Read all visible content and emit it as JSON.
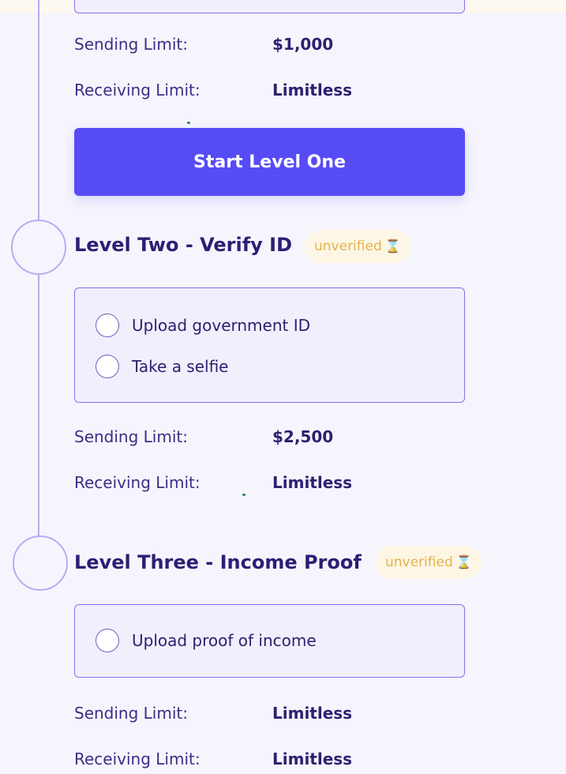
{
  "level_one": {
    "sending_label": "Sending Limit:",
    "sending_value": "$1,000",
    "receiving_label": "Receiving Limit:",
    "receiving_value": "Limitless",
    "start_button_label": "Start Level One"
  },
  "level_two": {
    "title": "Level Two - Verify ID",
    "status": "unverified",
    "status_icon": "hourglass-icon",
    "tasks": [
      {
        "label": "Upload government ID"
      },
      {
        "label": "Take a selfie"
      }
    ],
    "sending_label": "Sending Limit:",
    "sending_value": "$2,500",
    "receiving_label": "Receiving Limit:",
    "receiving_value": "Limitless"
  },
  "level_three": {
    "title": "Level Three - Income Proof",
    "status": "unverified",
    "status_icon": "hourglass-icon",
    "tasks": [
      {
        "label": "Upload proof of income"
      }
    ],
    "sending_label": "Sending Limit:",
    "sending_value": "Limitless",
    "receiving_label": "Receiving Limit:",
    "receiving_value": "Limitless"
  },
  "colors": {
    "accent": "#574bf5",
    "title": "#2b1f75",
    "badge_text": "#e3b34d",
    "badge_bg": "#fdf6e4",
    "card_border": "#8b6cf0",
    "timeline": "#b9abf3"
  }
}
